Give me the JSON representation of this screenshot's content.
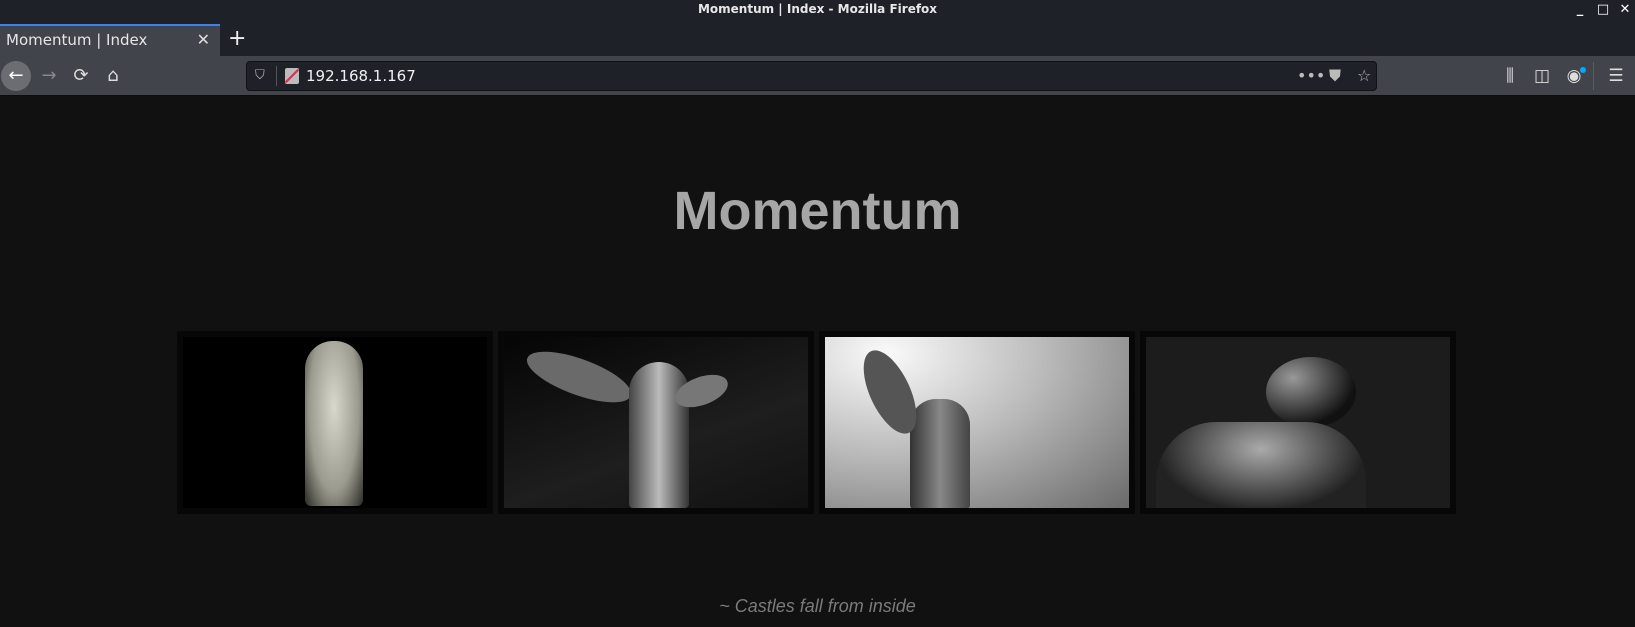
{
  "window": {
    "title": "Momentum | Index - Mozilla Firefox",
    "controls": [
      "minimize",
      "maximize",
      "close"
    ]
  },
  "tab": {
    "label": "Momentum | Index"
  },
  "address_bar": {
    "url": "192.168.1.167"
  },
  "icons": [
    "back-icon",
    "forward-icon",
    "reload-icon",
    "home-icon",
    "shield-icon",
    "insecure-lock-icon",
    "more-icon",
    "pocket-icon",
    "bookmark-star-icon",
    "library-icon",
    "sidebar-icon",
    "account-icon",
    "menu-icon"
  ],
  "page": {
    "heading": "Momentum",
    "gallery": [
      "gargoyle statue",
      "angel statue with book",
      "angels against clouded sky",
      "statue silhouette"
    ],
    "quote": "~ Castles fall from inside"
  },
  "colors": {
    "background": "#111111",
    "heading": "#a6a6a6",
    "quote": "#7b7b7b",
    "tab_accent": "#3b82f0"
  }
}
